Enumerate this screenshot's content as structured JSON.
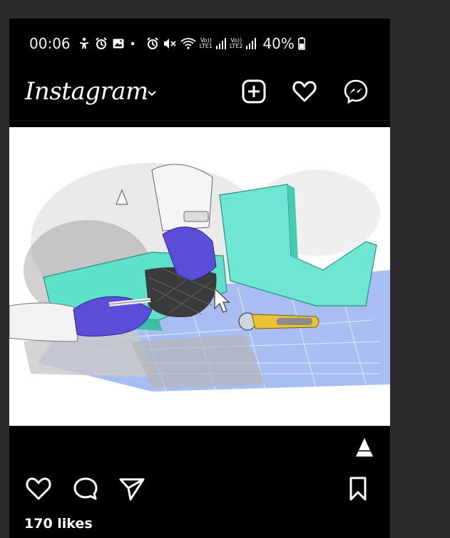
{
  "status_bar": {
    "time": "00:06",
    "lte1_top": "Vo))",
    "lte1_bottom": "LTE1",
    "lte2_top": "Vo))",
    "lte2_bottom": "LTE2",
    "battery": "40%"
  },
  "header": {
    "logo": "Instagram",
    "icons": [
      "add-post-icon",
      "heart-icon",
      "messenger-icon"
    ]
  },
  "post": {
    "image_description_icon": "warning-triangle-icon",
    "likes": "170 likes"
  },
  "actions": [
    "like-icon",
    "comment-icon",
    "share-icon",
    "bookmark-icon"
  ],
  "colors": {
    "background": "#000000",
    "mold_teal": "#5fe0c8",
    "glove_purple": "#5a4fd6",
    "mat_blue": "#9fb7f0"
  }
}
